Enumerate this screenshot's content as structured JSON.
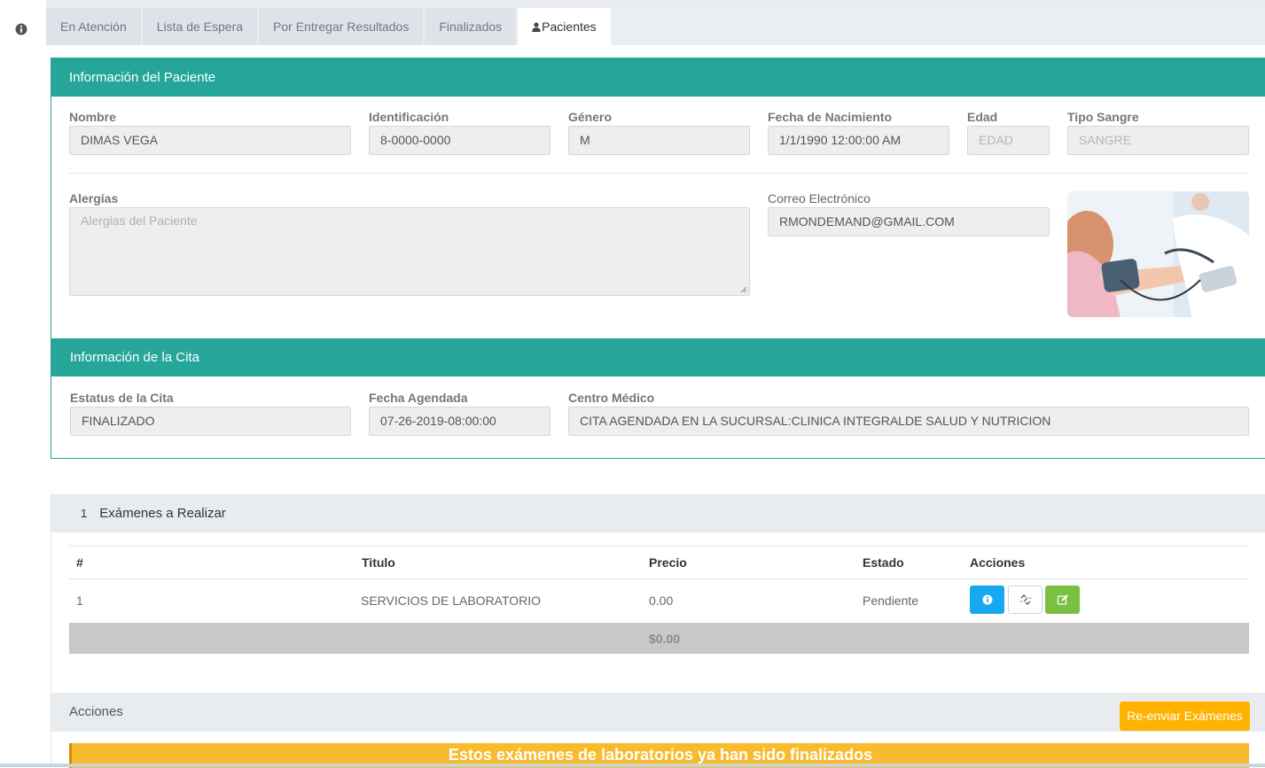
{
  "tabs": [
    {
      "label": "En Atención"
    },
    {
      "label": "Lista de Espera"
    },
    {
      "label": "Por Entregar Resultados"
    },
    {
      "label": "Finalizados"
    },
    {
      "label": "Pacientes",
      "icon": "user-icon",
      "active": true
    }
  ],
  "patient": {
    "title": "Información del Paciente",
    "nombre_label": "Nombre",
    "nombre": "DIMAS VEGA",
    "identificacion_label": "Identificación",
    "identificacion": "8-0000-0000",
    "genero_label": "Género",
    "genero": "M",
    "fecha_nac_label": "Fecha de Nacimiento",
    "fecha_nac": "1/1/1990 12:00:00 AM",
    "edad_label": "Edad",
    "edad_placeholder": "EDAD",
    "tipo_sangre_label": "Tipo Sangre",
    "tipo_sangre_placeholder": "SANGRE",
    "alergias_label": "Alergías",
    "alergias_placeholder": "Alergias del Paciente",
    "correo_label": "Correo Electrónico",
    "correo": "RMONDEMAND@GMAIL.COM"
  },
  "cita": {
    "title": "Información de la Cita",
    "estatus_label": "Estatus de la Cita",
    "estatus": "FINALIZADO",
    "fecha_label": "Fecha Agendada",
    "fecha": "07-26-2019-08:00:00",
    "centro_label": "Centro Médico",
    "centro": "CITA AGENDADA EN LA SUCURSAL:CLINICA INTEGRALDE SALUD Y NUTRICION"
  },
  "exams": {
    "count": "1",
    "title": "Exámenes a Realizar",
    "headers": {
      "num": "#",
      "titulo": "Titulo",
      "precio": "Precio",
      "estado": "Estado",
      "acciones": "Acciones"
    },
    "rows": [
      {
        "num": "1",
        "titulo": "SERVICIOS DE LABORATORIO",
        "precio": "0.00",
        "estado": "Pendiente"
      }
    ],
    "total": "$0.00"
  },
  "actions": {
    "title": "Acciones",
    "resend_label": "Re-enviar Exámenes",
    "alert": "Estos exámenes de laboratorios ya han sido finalizados"
  },
  "colors": {
    "teal": "#26a69a",
    "info": "#16a9f0",
    "success": "#7ac142",
    "warning": "#ffb300"
  }
}
